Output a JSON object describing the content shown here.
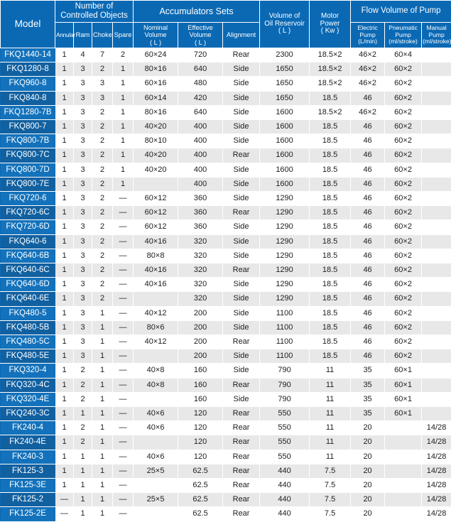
{
  "table": {
    "headers": {
      "model": "Model",
      "controlled_objects": "Number of Controlled Objects",
      "annular": "Annular",
      "ram": "Ram",
      "choke": "Choke",
      "spare": "Spare",
      "accumulators": "Accumulators Sets",
      "nominal_volume": "Nominal Volume ( L )",
      "nominal_volume_l1": "Nominal",
      "nominal_volume_l2": "Volume",
      "nominal_volume_l3": "( L )",
      "effective_volume_l1": "Effective",
      "effective_volume_l2": "Volume",
      "effective_volume_l3": "( L )",
      "alignment": "Alignment",
      "oil_reservoir_l1": "Volume of",
      "oil_reservoir_l2": "Oil Reservoir",
      "oil_reservoir_l3": "( L )",
      "motor_power_l1": "Motor",
      "motor_power_l2": "Power",
      "motor_power_l3": "( Kw )",
      "flow_volume_of_pump": "Flow Volume of Pump",
      "electric_pump_l1": "Electric",
      "electric_pump_l2": "Pump",
      "electric_pump_l3": "(L/min)",
      "pneumatic_pump_l1": "Pneumatic",
      "pneumatic_pump_l2": "Pump",
      "pneumatic_pump_l3": "(ml/stroke)",
      "manual_pump_l1": "Manual",
      "manual_pump_l2": "Pump",
      "manual_pump_l3": "(ml/stroke)"
    },
    "columns": [
      "model",
      "annular",
      "ram",
      "choke",
      "spare",
      "nominal_volume",
      "effective_volume",
      "alignment",
      "oil_reservoir",
      "motor_power",
      "electric_pump",
      "pneumatic_pump",
      "manual_pump"
    ],
    "rows": [
      {
        "model": "FKQ1440-14",
        "annular": "1",
        "ram": "4",
        "choke": "7",
        "spare": "2",
        "nominal_volume": "60×24",
        "effective_volume": "720",
        "alignment": "Rear",
        "oil_reservoir": "2300",
        "motor_power": "18.5×2",
        "electric_pump": "46×2",
        "pneumatic_pump": "60×4",
        "manual_pump": ""
      },
      {
        "model": "FKQ1280-8",
        "annular": "1",
        "ram": "3",
        "choke": "2",
        "spare": "1",
        "nominal_volume": "80×16",
        "effective_volume": "640",
        "alignment": "Side",
        "oil_reservoir": "1650",
        "motor_power": "18.5×2",
        "electric_pump": "46×2",
        "pneumatic_pump": "60×2",
        "manual_pump": ""
      },
      {
        "model": "FKQ960-8",
        "annular": "1",
        "ram": "3",
        "choke": "3",
        "spare": "1",
        "nominal_volume": "60×16",
        "effective_volume": "480",
        "alignment": "Side",
        "oil_reservoir": "1650",
        "motor_power": "18.5×2",
        "electric_pump": "46×2",
        "pneumatic_pump": "60×2",
        "manual_pump": ""
      },
      {
        "model": "FKQ840-8",
        "annular": "1",
        "ram": "3",
        "choke": "3",
        "spare": "1",
        "nominal_volume": "60×14",
        "effective_volume": "420",
        "alignment": "Side",
        "oil_reservoir": "1650",
        "motor_power": "18.5",
        "electric_pump": "46",
        "pneumatic_pump": "60×2",
        "manual_pump": ""
      },
      {
        "model": "FKQ1280-7B",
        "annular": "1",
        "ram": "3",
        "choke": "2",
        "spare": "1",
        "nominal_volume": "80×16",
        "effective_volume": "640",
        "alignment": "Side",
        "oil_reservoir": "1600",
        "motor_power": "18.5×2",
        "electric_pump": "46×2",
        "pneumatic_pump": "60×2",
        "manual_pump": ""
      },
      {
        "model": "FKQ800-7",
        "annular": "1",
        "ram": "3",
        "choke": "2",
        "spare": "1",
        "nominal_volume": "40×20",
        "effective_volume": "400",
        "alignment": "Side",
        "oil_reservoir": "1600",
        "motor_power": "18.5",
        "electric_pump": "46",
        "pneumatic_pump": "60×2",
        "manual_pump": ""
      },
      {
        "model": "FKQ800-7B",
        "annular": "1",
        "ram": "3",
        "choke": "2",
        "spare": "1",
        "nominal_volume": "80×10",
        "effective_volume": "400",
        "alignment": "Side",
        "oil_reservoir": "1600",
        "motor_power": "18.5",
        "electric_pump": "46",
        "pneumatic_pump": "60×2",
        "manual_pump": ""
      },
      {
        "model": "FKQ800-7C",
        "annular": "1",
        "ram": "3",
        "choke": "2",
        "spare": "1",
        "nominal_volume": "40×20",
        "effective_volume": "400",
        "alignment": "Rear",
        "oil_reservoir": "1600",
        "motor_power": "18.5",
        "electric_pump": "46",
        "pneumatic_pump": "60×2",
        "manual_pump": ""
      },
      {
        "model": "FKQ800-7D",
        "annular": "1",
        "ram": "3",
        "choke": "2",
        "spare": "1",
        "nominal_volume": "40×20",
        "effective_volume": "400",
        "alignment": "Side",
        "oil_reservoir": "1600",
        "motor_power": "18.5",
        "electric_pump": "46",
        "pneumatic_pump": "60×2",
        "manual_pump": ""
      },
      {
        "model": "FKQ800-7E",
        "annular": "1",
        "ram": "3",
        "choke": "2",
        "spare": "1",
        "nominal_volume": "",
        "effective_volume": "400",
        "alignment": "Side",
        "oil_reservoir": "1600",
        "motor_power": "18.5",
        "electric_pump": "46",
        "pneumatic_pump": "60×2",
        "manual_pump": ""
      },
      {
        "model": "FKQ720-6",
        "annular": "1",
        "ram": "3",
        "choke": "2",
        "spare": "—",
        "nominal_volume": "60×12",
        "effective_volume": "360",
        "alignment": "Side",
        "oil_reservoir": "1290",
        "motor_power": "18.5",
        "electric_pump": "46",
        "pneumatic_pump": "60×2",
        "manual_pump": ""
      },
      {
        "model": "FKQ720-6C",
        "annular": "1",
        "ram": "3",
        "choke": "2",
        "spare": "—",
        "nominal_volume": "60×12",
        "effective_volume": "360",
        "alignment": "Rear",
        "oil_reservoir": "1290",
        "motor_power": "18.5",
        "electric_pump": "46",
        "pneumatic_pump": "60×2",
        "manual_pump": ""
      },
      {
        "model": "FKQ720-6D",
        "annular": "1",
        "ram": "3",
        "choke": "2",
        "spare": "—",
        "nominal_volume": "60×12",
        "effective_volume": "360",
        "alignment": "Side",
        "oil_reservoir": "1290",
        "motor_power": "18.5",
        "electric_pump": "46",
        "pneumatic_pump": "60×2",
        "manual_pump": ""
      },
      {
        "model": "FKQ640-6",
        "annular": "1",
        "ram": "3",
        "choke": "2",
        "spare": "—",
        "nominal_volume": "40×16",
        "effective_volume": "320",
        "alignment": "Side",
        "oil_reservoir": "1290",
        "motor_power": "18.5",
        "electric_pump": "46",
        "pneumatic_pump": "60×2",
        "manual_pump": ""
      },
      {
        "model": "FKQ640-6B",
        "annular": "1",
        "ram": "3",
        "choke": "2",
        "spare": "—",
        "nominal_volume": "80×8",
        "effective_volume": "320",
        "alignment": "Side",
        "oil_reservoir": "1290",
        "motor_power": "18.5",
        "electric_pump": "46",
        "pneumatic_pump": "60×2",
        "manual_pump": ""
      },
      {
        "model": "FKQ640-6C",
        "annular": "1",
        "ram": "3",
        "choke": "2",
        "spare": "—",
        "nominal_volume": "40×16",
        "effective_volume": "320",
        "alignment": "Rear",
        "oil_reservoir": "1290",
        "motor_power": "18.5",
        "electric_pump": "46",
        "pneumatic_pump": "60×2",
        "manual_pump": ""
      },
      {
        "model": "FKQ640-6D",
        "annular": "1",
        "ram": "3",
        "choke": "2",
        "spare": "—",
        "nominal_volume": "40×16",
        "effective_volume": "320",
        "alignment": "Side",
        "oil_reservoir": "1290",
        "motor_power": "18.5",
        "electric_pump": "46",
        "pneumatic_pump": "60×2",
        "manual_pump": ""
      },
      {
        "model": "FKQ640-6E",
        "annular": "1",
        "ram": "3",
        "choke": "2",
        "spare": "—",
        "nominal_volume": "",
        "effective_volume": "320",
        "alignment": "Side",
        "oil_reservoir": "1290",
        "motor_power": "18.5",
        "electric_pump": "46",
        "pneumatic_pump": "60×2",
        "manual_pump": ""
      },
      {
        "model": "FKQ480-5",
        "annular": "1",
        "ram": "3",
        "choke": "1",
        "spare": "—",
        "nominal_volume": "40×12",
        "effective_volume": "200",
        "alignment": "Side",
        "oil_reservoir": "1100",
        "motor_power": "18.5",
        "electric_pump": "46",
        "pneumatic_pump": "60×2",
        "manual_pump": ""
      },
      {
        "model": "FKQ480-5B",
        "annular": "1",
        "ram": "3",
        "choke": "1",
        "spare": "—",
        "nominal_volume": "80×6",
        "effective_volume": "200",
        "alignment": "Side",
        "oil_reservoir": "1100",
        "motor_power": "18.5",
        "electric_pump": "46",
        "pneumatic_pump": "60×2",
        "manual_pump": ""
      },
      {
        "model": "FKQ480-5C",
        "annular": "1",
        "ram": "3",
        "choke": "1",
        "spare": "—",
        "nominal_volume": "40×12",
        "effective_volume": "200",
        "alignment": "Rear",
        "oil_reservoir": "1100",
        "motor_power": "18.5",
        "electric_pump": "46",
        "pneumatic_pump": "60×2",
        "manual_pump": ""
      },
      {
        "model": "FKQ480-5E",
        "annular": "1",
        "ram": "3",
        "choke": "1",
        "spare": "—",
        "nominal_volume": "",
        "effective_volume": "200",
        "alignment": "Side",
        "oil_reservoir": "1100",
        "motor_power": "18.5",
        "electric_pump": "46",
        "pneumatic_pump": "60×2",
        "manual_pump": ""
      },
      {
        "model": "FKQ320-4",
        "annular": "1",
        "ram": "2",
        "choke": "1",
        "spare": "—",
        "nominal_volume": "40×8",
        "effective_volume": "160",
        "alignment": "Side",
        "oil_reservoir": "790",
        "motor_power": "11",
        "electric_pump": "35",
        "pneumatic_pump": "60×1",
        "manual_pump": ""
      },
      {
        "model": "FKQ320-4C",
        "annular": "1",
        "ram": "2",
        "choke": "1",
        "spare": "—",
        "nominal_volume": "40×8",
        "effective_volume": "160",
        "alignment": "Rear",
        "oil_reservoir": "790",
        "motor_power": "11",
        "electric_pump": "35",
        "pneumatic_pump": "60×1",
        "manual_pump": ""
      },
      {
        "model": "FKQ320-4E",
        "annular": "1",
        "ram": "2",
        "choke": "1",
        "spare": "—",
        "nominal_volume": "",
        "effective_volume": "160",
        "alignment": "Side",
        "oil_reservoir": "790",
        "motor_power": "11",
        "electric_pump": "35",
        "pneumatic_pump": "60×1",
        "manual_pump": ""
      },
      {
        "model": "FKQ240-3C",
        "annular": "1",
        "ram": "1",
        "choke": "1",
        "spare": "—",
        "nominal_volume": "40×6",
        "effective_volume": "120",
        "alignment": "Rear",
        "oil_reservoir": "550",
        "motor_power": "11",
        "electric_pump": "35",
        "pneumatic_pump": "60×1",
        "manual_pump": ""
      },
      {
        "model": "FK240-4",
        "annular": "1",
        "ram": "2",
        "choke": "1",
        "spare": "—",
        "nominal_volume": "40×6",
        "effective_volume": "120",
        "alignment": "Rear",
        "oil_reservoir": "550",
        "motor_power": "11",
        "electric_pump": "20",
        "pneumatic_pump": "",
        "manual_pump": "14/28"
      },
      {
        "model": "FK240-4E",
        "annular": "1",
        "ram": "2",
        "choke": "1",
        "spare": "—",
        "nominal_volume": "",
        "effective_volume": "120",
        "alignment": "Rear",
        "oil_reservoir": "550",
        "motor_power": "11",
        "electric_pump": "20",
        "pneumatic_pump": "",
        "manual_pump": "14/28"
      },
      {
        "model": "FK240-3",
        "annular": "1",
        "ram": "1",
        "choke": "1",
        "spare": "—",
        "nominal_volume": "40×6",
        "effective_volume": "120",
        "alignment": "Rear",
        "oil_reservoir": "550",
        "motor_power": "11",
        "electric_pump": "20",
        "pneumatic_pump": "",
        "manual_pump": "14/28"
      },
      {
        "model": "FK125-3",
        "annular": "1",
        "ram": "1",
        "choke": "1",
        "spare": "—",
        "nominal_volume": "25×5",
        "effective_volume": "62.5",
        "alignment": "Rear",
        "oil_reservoir": "440",
        "motor_power": "7.5",
        "electric_pump": "20",
        "pneumatic_pump": "",
        "manual_pump": "14/28"
      },
      {
        "model": "FK125-3E",
        "annular": "1",
        "ram": "1",
        "choke": "1",
        "spare": "—",
        "nominal_volume": "",
        "effective_volume": "62.5",
        "alignment": "Rear",
        "oil_reservoir": "440",
        "motor_power": "7.5",
        "electric_pump": "20",
        "pneumatic_pump": "",
        "manual_pump": "14/28"
      },
      {
        "model": "FK125-2",
        "annular": "—",
        "ram": "1",
        "choke": "1",
        "spare": "—",
        "nominal_volume": "25×5",
        "effective_volume": "62.5",
        "alignment": "Rear",
        "oil_reservoir": "440",
        "motor_power": "7.5",
        "electric_pump": "20",
        "pneumatic_pump": "",
        "manual_pump": "14/28"
      },
      {
        "model": "FK125-2E",
        "annular": "—",
        "ram": "1",
        "choke": "1",
        "spare": "—",
        "nominal_volume": "",
        "effective_volume": "62.5",
        "alignment": "Rear",
        "oil_reservoir": "440",
        "motor_power": "7.5",
        "electric_pump": "20",
        "pneumatic_pump": "",
        "manual_pump": "14/28"
      }
    ]
  },
  "colors": {
    "header_blue": "#0b69b4",
    "model_blue": "#1372bb",
    "model_blue_alt": "#1160a0",
    "row_alt_gray": "#e8e8e8"
  }
}
